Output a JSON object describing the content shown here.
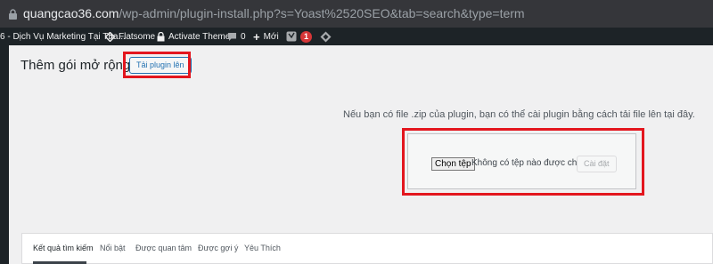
{
  "browser": {
    "url_domain": "quangcao36.com",
    "url_path": "/wp-admin/plugin-install.php?s=Yoast%2520SEO&tab=search&type=term"
  },
  "adminbar": {
    "site_name": "6 - Dịch Vụ Marketing Tại Tha...",
    "theme_link": "Flatsome",
    "activate_theme": "Activate Theme",
    "comments_count": "0",
    "new_label": "Mới",
    "yoast_badge": "1"
  },
  "page": {
    "title": "Thêm gói mở rộng",
    "upload_toggle": "Tải plugin lên",
    "help_text": "Nếu bạn có file .zip của plugin, bạn có thể cài plugin bằng cách tải file lên tại đây.",
    "choose_file": "Chọn tệp",
    "no_file": "Không có tệp nào được chọn",
    "install_button": "Cài đặt"
  },
  "filter_tabs": [
    {
      "label": "Kết quả tìm kiếm"
    },
    {
      "label": "Nổi bật"
    },
    {
      "label": "Được quan tâm"
    },
    {
      "label": "Được gợi ý"
    },
    {
      "label": "Yêu Thích"
    }
  ],
  "colors": {
    "highlight": "#e3161e",
    "wp_blue": "#2271b1",
    "adminbar_bg": "#1d2327"
  }
}
